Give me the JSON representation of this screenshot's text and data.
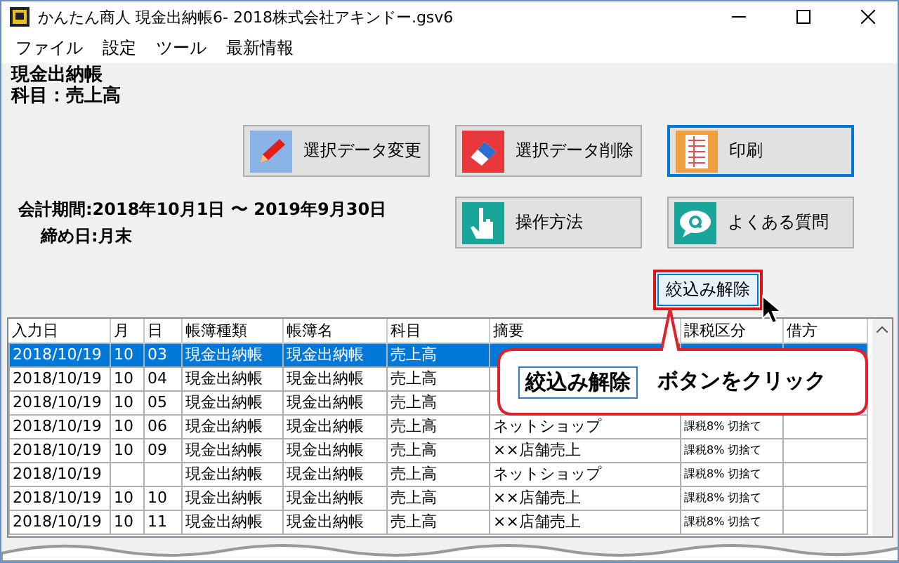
{
  "window": {
    "title": "かんたん商人 現金出納帳6- 2018株式会社アキンドー.gsv6"
  },
  "menu": [
    "ファイル",
    "設定",
    "ツール",
    "最新情報"
  ],
  "header": {
    "ledger": "現金出納帳",
    "account": "科目：売上高"
  },
  "period": {
    "term": "会計期間:2018年10月1日 〜 2019年9月30日",
    "closing": "締め日:月末"
  },
  "buttons": [
    {
      "label": "選択データ変更",
      "kind": "edit",
      "focused": false
    },
    {
      "label": "選択データ削除",
      "kind": "delete",
      "focused": false
    },
    {
      "label": "印刷",
      "kind": "print",
      "focused": true
    },
    {
      "label": "操作方法",
      "kind": "howto",
      "focused": false
    },
    {
      "label": "よくある質問",
      "kind": "faq",
      "focused": false
    }
  ],
  "filter_button": {
    "label": "絞込み解除",
    "highlighted": true
  },
  "table": {
    "columns": [
      "入力日",
      "月",
      "日",
      "帳簿種類",
      "帳簿名",
      "科目",
      "摘要",
      "課税区分",
      "借方"
    ],
    "rows": [
      {
        "selected": true,
        "cells": [
          "2018/10/19",
          "10",
          "03",
          "現金出納帳",
          "現金出納帳",
          "売上高",
          "",
          "",
          ""
        ]
      },
      {
        "selected": false,
        "cells": [
          "2018/10/19",
          "10",
          "04",
          "現金出納帳",
          "現金出納帳",
          "売上高",
          "",
          "",
          ""
        ]
      },
      {
        "selected": false,
        "cells": [
          "2018/10/19",
          "10",
          "05",
          "現金出納帳",
          "現金出納帳",
          "売上高",
          "",
          "",
          ""
        ]
      },
      {
        "selected": false,
        "cells": [
          "2018/10/19",
          "10",
          "06",
          "現金出納帳",
          "現金出納帳",
          "売上高",
          "ネットショップ",
          "課税8% 切捨て",
          ""
        ]
      },
      {
        "selected": false,
        "cells": [
          "2018/10/19",
          "10",
          "09",
          "現金出納帳",
          "現金出納帳",
          "売上高",
          "××店舗売上",
          "課税8% 切捨て",
          ""
        ]
      },
      {
        "selected": false,
        "cells": [
          "2018/10/19",
          "",
          "",
          "現金出納帳",
          "現金出納帳",
          "売上高",
          "ネットショップ",
          "課税8% 切捨て",
          ""
        ]
      },
      {
        "selected": false,
        "cells": [
          "2018/10/19",
          "10",
          "10",
          "現金出納帳",
          "現金出納帳",
          "売上高",
          "××店舗売上",
          "課税8% 切捨て",
          ""
        ]
      },
      {
        "selected": false,
        "cells": [
          "2018/10/19",
          "10",
          "11",
          "現金出納帳",
          "現金出納帳",
          "売上高",
          "××店舗売上",
          "課税8% 切捨て",
          ""
        ]
      }
    ]
  },
  "callout": {
    "button_label": "絞込み解除",
    "text": "ボタンをクリック"
  }
}
